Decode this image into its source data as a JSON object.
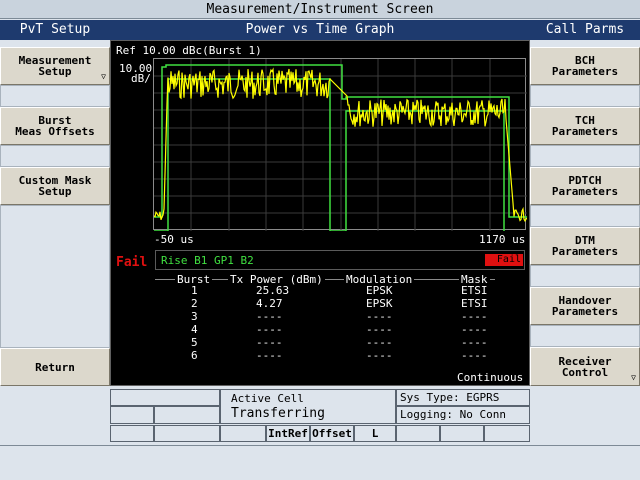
{
  "window": {
    "title": "Measurement/Instrument Screen"
  },
  "left_panel": {
    "heading": "PvT Setup",
    "keys": [
      {
        "label": "Measurement\nSetup",
        "more": true
      },
      {
        "label": "Burst\nMeas Offsets",
        "more": false
      },
      {
        "label": "Custom Mask\nSetup",
        "more": false
      },
      {
        "label": "Return",
        "more": false
      }
    ]
  },
  "right_panel": {
    "heading": "Call Parms",
    "keys": [
      {
        "label": "BCH\nParameters",
        "more": false
      },
      {
        "label": "TCH\nParameters",
        "more": false
      },
      {
        "label": "PDTCH\nParameters",
        "more": false
      },
      {
        "label": "DTM\nParameters",
        "more": false
      },
      {
        "label": "Handover\nParameters",
        "more": false
      },
      {
        "label": "Receiver\nControl",
        "more": true
      }
    ],
    "more_glyph": "▽"
  },
  "graph": {
    "heading": "Power vs Time Graph",
    "ref_text": "Ref  10.00 dBc(Burst 1)",
    "scale_value": "10.00",
    "scale_unit": "dB/",
    "x_start": "-50 us",
    "x_end": "1170 us",
    "trace_color": "#ffff00",
    "mask_color": "#40e040"
  },
  "result": {
    "overall": "Fail",
    "segments": "Rise  B1  GP1  B2",
    "segment_status": "Fail",
    "fail_color": "#e01010"
  },
  "table": {
    "headers": [
      "Burst",
      "Tx Power (dBm)",
      "Modulation",
      "Mask"
    ],
    "rows": [
      [
        "1",
        "25.63",
        "EPSK",
        "ETSI"
      ],
      [
        "2",
        "4.27",
        "EPSK",
        "ETSI"
      ],
      [
        "3",
        "----",
        "----",
        "----"
      ],
      [
        "4",
        "----",
        "----",
        "----"
      ],
      [
        "5",
        "----",
        "----",
        "----"
      ],
      [
        "6",
        "----",
        "----",
        "----"
      ]
    ],
    "mode": "Continuous"
  },
  "status": {
    "cell_label": "Active Cell",
    "cell_state": "Transferring",
    "sys_type": "Sys Type: EGPRS",
    "logging": "Logging: No Conn",
    "intref": "IntRef",
    "offset": "Offset",
    "l_flag": "L"
  }
}
